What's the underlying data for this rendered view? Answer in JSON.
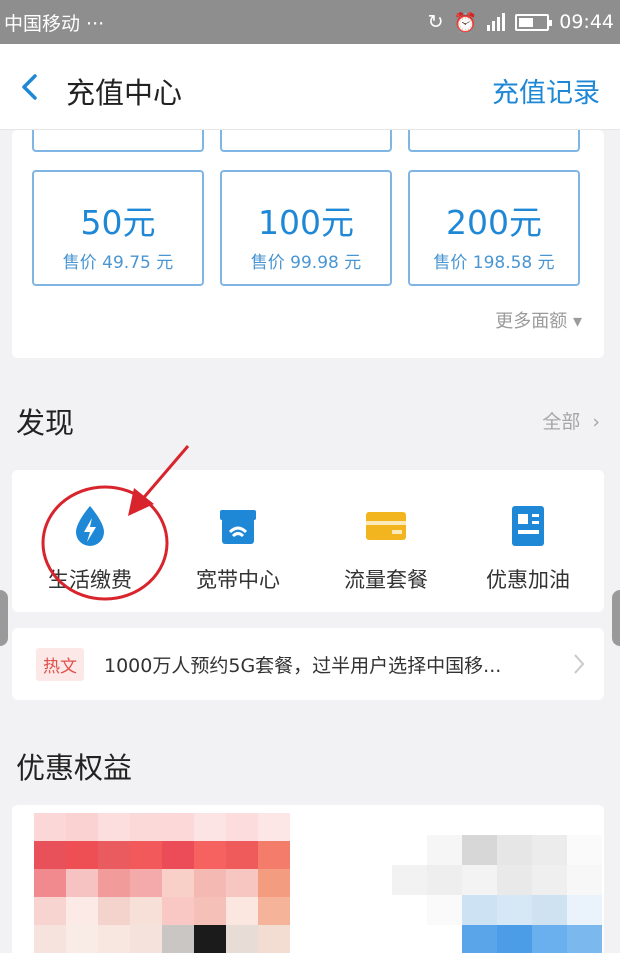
{
  "status_bar": {
    "carrier": "中国移动 ···",
    "time": "09:44"
  },
  "header": {
    "title": "充值中心",
    "right_link": "充值记录"
  },
  "recharge": {
    "tiles": [
      {
        "amount": "50元",
        "price": "售价 49.75 元"
      },
      {
        "amount": "100元",
        "price": "售价 99.98 元"
      },
      {
        "amount": "200元",
        "price": "售价 198.58 元"
      }
    ],
    "more_label": "更多面额 ▾"
  },
  "discover": {
    "title": "发现",
    "all_label": "全部",
    "services": [
      {
        "label": "生活缴费",
        "icon": "water-drop-bolt-icon"
      },
      {
        "label": "宽带中心",
        "icon": "broadband-router-icon"
      },
      {
        "label": "流量套餐",
        "icon": "data-card-icon"
      },
      {
        "label": "优惠加油",
        "icon": "fuel-card-icon"
      }
    ]
  },
  "hot_article": {
    "tag": "热文",
    "text": "1000万人预约5G套餐，过半用户选择中国移..."
  },
  "benefits": {
    "title": "优惠权益"
  },
  "colors": {
    "accent": "#1e88d6",
    "tile_border": "#7fb6e3",
    "hot_tag": "#e0504a",
    "annotation": "#d8242c",
    "fuel_icon": "#f2b51f"
  }
}
